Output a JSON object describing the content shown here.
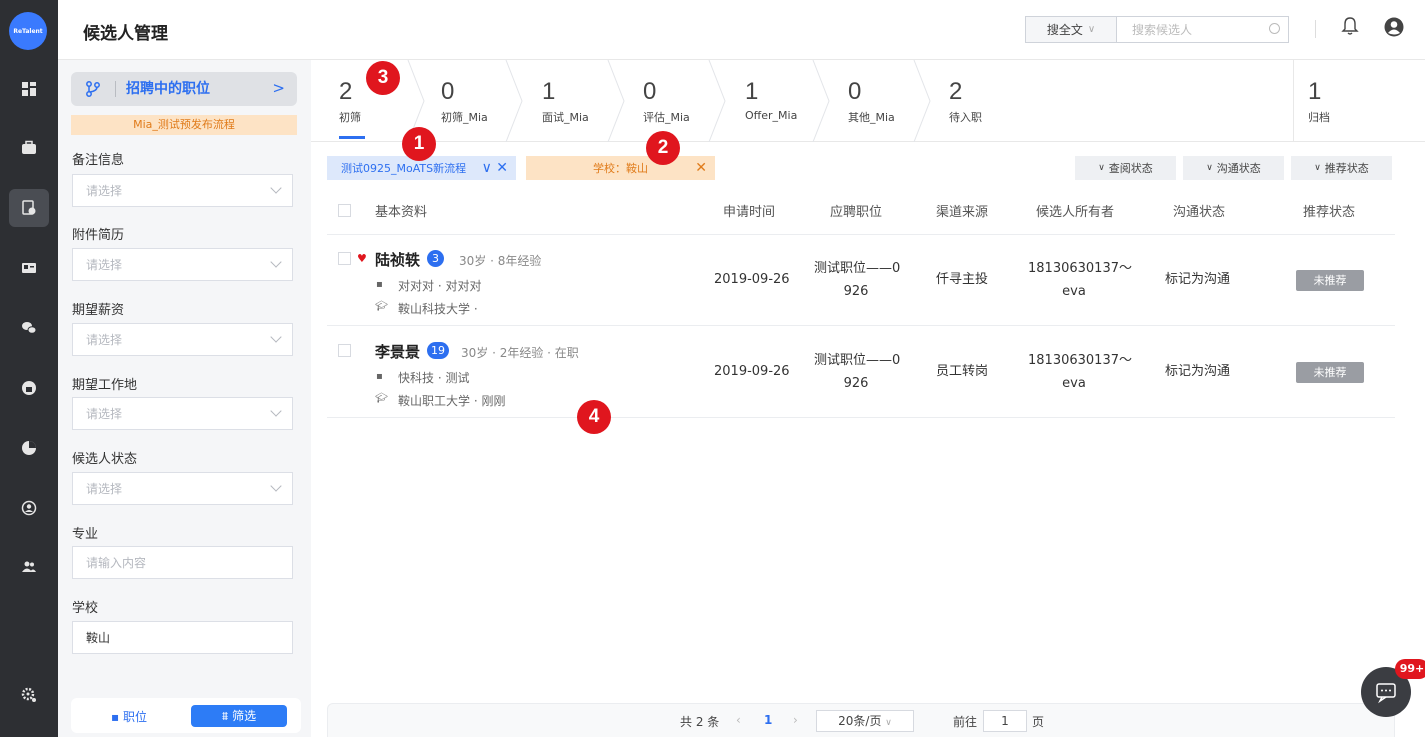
{
  "app": {
    "logo_text": "ReTalent"
  },
  "header": {
    "title": "候选人管理",
    "search_scope": "搜全文",
    "search_placeholder": "搜索候选人"
  },
  "sidebar": {
    "job_button": "招聘中的职位",
    "flow_label": "Mia_测试预发布流程",
    "filters": [
      {
        "label": "备注信息",
        "value": "请选择"
      },
      {
        "label": "附件简历",
        "value": "请选择"
      },
      {
        "label": "期望薪资",
        "value": "请选择"
      },
      {
        "label": "期望工作地",
        "value": "请选择"
      },
      {
        "label": "候选人状态",
        "value": "请选择"
      },
      {
        "label": "专业",
        "value": "请输入内容"
      },
      {
        "label": "学校",
        "value": "鞍山"
      }
    ],
    "bottom_job": "职位",
    "bottom_filter": "筛选"
  },
  "stages": [
    {
      "count": "2",
      "label": "初筛"
    },
    {
      "count": "0",
      "label": "初筛_Mia"
    },
    {
      "count": "1",
      "label": "面试_Mia"
    },
    {
      "count": "0",
      "label": "评估_Mia"
    },
    {
      "count": "1",
      "label": "Offer_Mia"
    },
    {
      "count": "0",
      "label": "其他_Mia"
    },
    {
      "count": "2",
      "label": "待入职"
    },
    {
      "count": "1",
      "label": "归档"
    }
  ],
  "chips": {
    "process": "测试0925_MoATS新流程",
    "school": "学校：鞍山"
  },
  "dropdowns": [
    "查阅状态",
    "沟通状态",
    "推荐状态"
  ],
  "markers": [
    "1",
    "2",
    "3",
    "4"
  ],
  "table": {
    "headers": [
      "基本资料",
      "申请时间",
      "应聘职位",
      "渠道来源",
      "候选人所有者",
      "沟通状态",
      "推荐状态"
    ],
    "rows": [
      {
        "name": "陆祯轶",
        "count": "3",
        "meta": "30岁 · 8年经验",
        "company": "对对对 · 对对对",
        "school": "鞍山科技大学 ·",
        "date": "2019-09-26",
        "job1": "测试职位——0",
        "job2": "926",
        "source": "仟寻主投",
        "owner1": "18130630137～",
        "owner2": "eva",
        "comm": "标记为沟通",
        "rec": "未推荐"
      },
      {
        "name": "李景景",
        "count": "19",
        "meta": "30岁 · 2年经验 · 在职",
        "company": "快科技 · 测试",
        "school": "鞍山职工大学 · 刚刚",
        "date": "2019-09-26",
        "job1": "测试职位——0",
        "job2": "926",
        "source": "员工转岗",
        "owner1": "18130630137～",
        "owner2": "eva",
        "comm": "标记为沟通",
        "rec": "未推荐"
      }
    ]
  },
  "pagination": {
    "total": "共 2 条",
    "current": "1",
    "page_size": "20条/页",
    "goto_label": "前往",
    "goto_value": "1",
    "page_unit": "页"
  },
  "chat_badge": "99+",
  "colors": {
    "accent": "#2d6ff0",
    "marker": "#e0161e",
    "rail": "#2d2f33"
  }
}
